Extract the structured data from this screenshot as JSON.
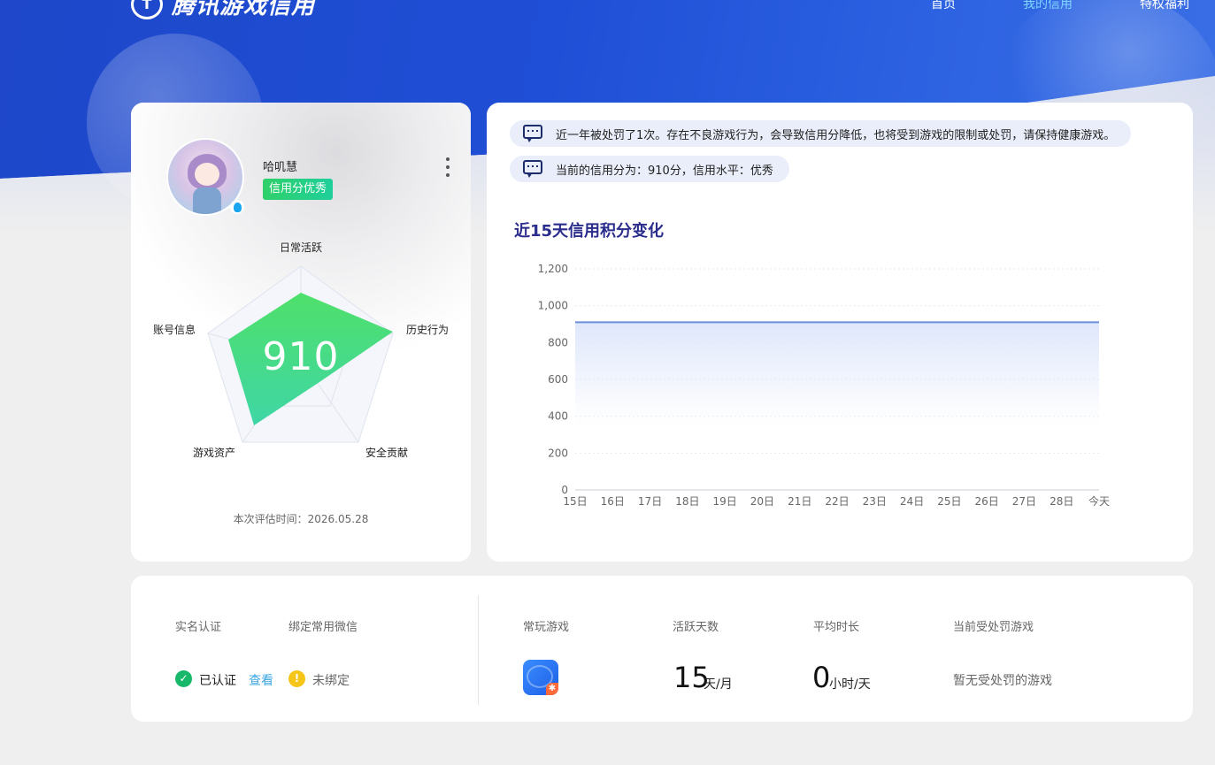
{
  "header": {
    "logo_text": "腾讯游戏信用",
    "nav": [
      "首页",
      "我的信用",
      "特权福利"
    ],
    "active_nav_index": 1
  },
  "profile": {
    "username": "哈叽慧",
    "credit_badge": "信用分优秀",
    "score": "910",
    "radar_labels": {
      "daily": "日常活跃",
      "history": "历史行为",
      "security": "安全贡献",
      "assets": "游戏资产",
      "account": "账号信息"
    },
    "eval_time": "本次评估时间：2026.05.28"
  },
  "notices": [
    "近一年被处罚了1次。存在不良游戏行为，会导致信用分降低，也将受到游戏的限制或处罚，请保持健康游戏。",
    "当前的信用分为：910分，信用水平：优秀"
  ],
  "chart_data": {
    "type": "area",
    "title": "近15天信用积分变化",
    "categories": [
      "15日",
      "16日",
      "17日",
      "18日",
      "19日",
      "20日",
      "21日",
      "22日",
      "23日",
      "24日",
      "25日",
      "26日",
      "27日",
      "28日",
      "今天"
    ],
    "values": [
      910,
      910,
      910,
      910,
      910,
      910,
      910,
      910,
      910,
      910,
      910,
      910,
      910,
      910,
      910
    ],
    "ylim": [
      0,
      1200
    ],
    "yticks": [
      "0",
      "200",
      "400",
      "600",
      "800",
      "1,000",
      "1,200"
    ],
    "xlabel": "",
    "ylabel": "",
    "grid": true,
    "line_color": "#6f8fd8",
    "fill_color": "#dfe7fb"
  },
  "stats": {
    "realname": {
      "label": "实名认证",
      "value": "已认证",
      "link": "查看"
    },
    "wechat": {
      "label": "绑定常用微信",
      "value": "未绑定"
    },
    "games": {
      "label": "常玩游戏"
    },
    "active_days": {
      "label": "活跃天数",
      "value": "15",
      "unit": "天/月"
    },
    "avg_time": {
      "label": "平均时长",
      "value": "0",
      "unit": "小时/天"
    },
    "punished": {
      "label": "当前受处罚游戏",
      "value": "暂无受处罚的游戏"
    }
  },
  "colors": {
    "hero_blue": "#1f4fd6",
    "radar_fill_start": "#4fe06a",
    "radar_fill_end": "#3fd6a6",
    "badge_green": "#2fd06a",
    "link_blue": "#3aa6e0",
    "title_navy": "#2b2d8c"
  }
}
